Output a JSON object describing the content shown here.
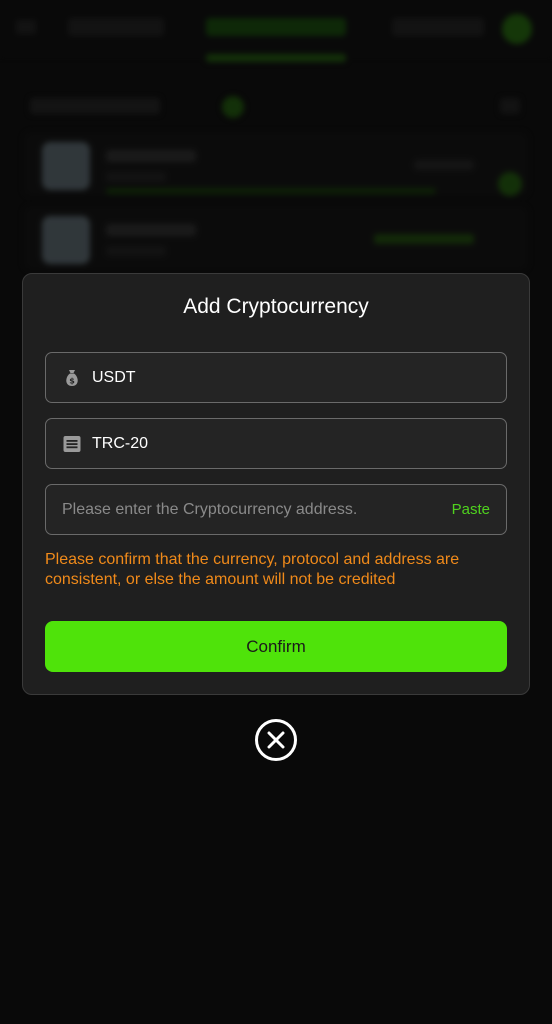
{
  "modal": {
    "title": "Add Cryptocurrency",
    "currency": {
      "value": "USDT",
      "icon": "money-bag-icon"
    },
    "protocol": {
      "value": "TRC-20",
      "icon": "list-icon"
    },
    "address": {
      "value": "",
      "placeholder": "Please enter the Cryptocurrency address.",
      "paste_label": "Paste"
    },
    "warning": "Please confirm that the currency, protocol and address are consistent, or else the amount will not be credited",
    "confirm_label": "Confirm",
    "close_icon": "close-icon"
  },
  "colors": {
    "accent": "#4fe30a",
    "paste": "#4fd11e",
    "warning": "#f08a1a",
    "modal_bg": "#1f1f1f",
    "page_bg": "#141414"
  }
}
